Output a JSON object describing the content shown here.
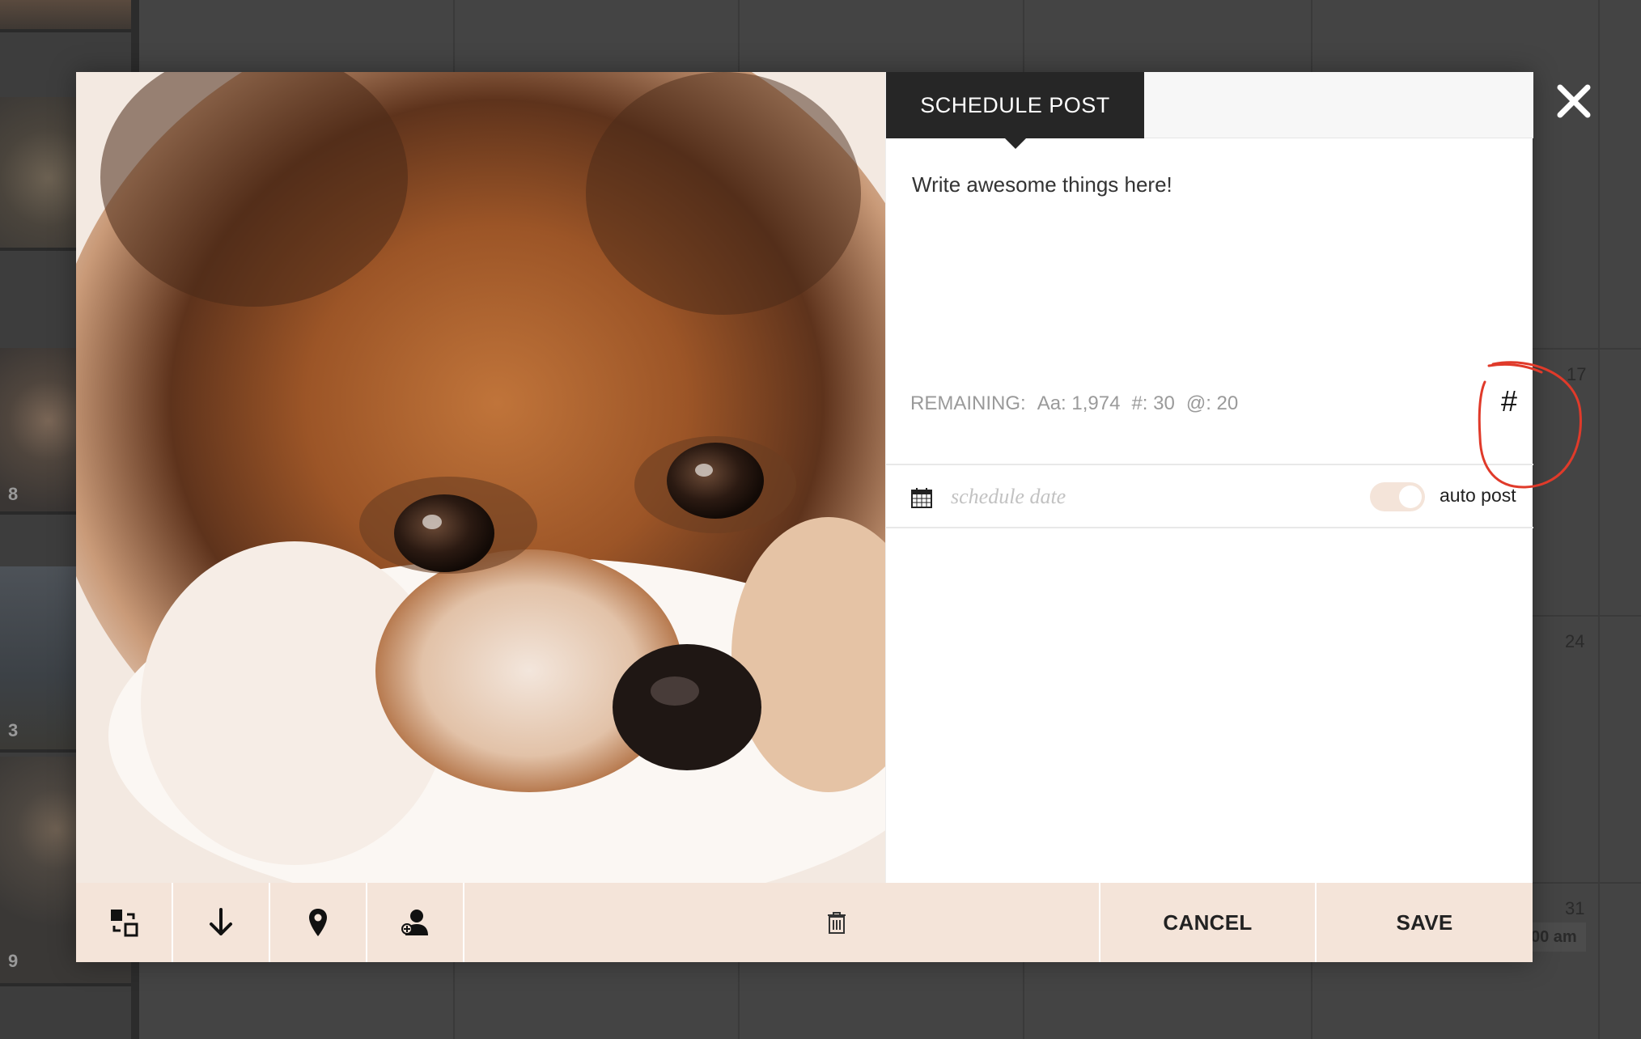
{
  "background": {
    "day_numbers": [
      "17",
      "24",
      "31"
    ],
    "thumb_counts": [
      "8",
      "3",
      "9"
    ],
    "time_chip": "00 am"
  },
  "modal": {
    "tab_label": "SCHEDULE POST",
    "caption_placeholder": "Write awesome things here!",
    "remaining": {
      "label": "REMAINING:",
      "chars": "Aa: 1,974",
      "hashtags": "#: 30",
      "mentions": "@: 20"
    },
    "hashtag_button": "#",
    "schedule_placeholder": "schedule date",
    "auto_post": {
      "label": "auto post",
      "enabled": false
    },
    "cancel_label": "CANCEL",
    "save_label": "SAVE"
  },
  "colors": {
    "accent_peach": "#f4e4d9",
    "tab_dark": "#262626",
    "annotation_red": "#e03a2a",
    "overlay_gray": "#444444"
  },
  "icons": {
    "toolbar": [
      "swap-media-icon",
      "download-icon",
      "location-pin-icon",
      "tag-user-icon",
      "trash-icon"
    ],
    "close": "close-icon",
    "calendar": "calendar-icon"
  }
}
